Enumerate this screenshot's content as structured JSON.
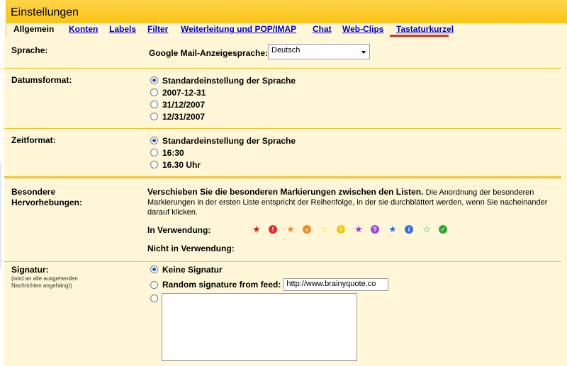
{
  "title": "Einstellungen",
  "tabs": [
    "Allgemein",
    "Konten",
    "Labels",
    "Filter",
    "Weiterleitung und POP/IMAP",
    "Chat",
    "Web-Clips",
    "Tastaturkurzel"
  ],
  "language": {
    "label": "Sprache:",
    "field_label": "Google Mail-Anzeigesprache:",
    "value": "Deutsch"
  },
  "date_format": {
    "label": "Datumsformat:",
    "options": [
      "Standardeinstellung der Sprache",
      "2007-12-31",
      "31/12/2007",
      "12/31/2007"
    ],
    "selected_index": 0
  },
  "time_format": {
    "label": "Zeitformat:",
    "options": [
      "Standardeinstellung der Sprache",
      "16:30",
      "16.30 Uhr"
    ],
    "selected_index": 0
  },
  "highlights": {
    "label_line1": "Besondere",
    "label_line2": "Hervorhebungen:",
    "desc_bold": "Verschieben Sie die besonderen Markierungen zwischen den Listen.",
    "desc_rest": "Die Anordnung der besonderen Markierungen in der ersten Liste entspricht der Reihenfolge, in der sie durchblättert werden, wenn Sie nacheinander darauf klicken.",
    "in_use_label": "In Verwendung:",
    "not_in_use_label": "Nicht in Verwendung:",
    "in_use_icons": [
      "red-star-icon",
      "red-bang-icon",
      "orange-star-icon",
      "orange-guillemet-icon",
      "yellow-star-icon",
      "yellow-bang-icon",
      "purple-star-icon",
      "purple-question-icon",
      "blue-star-icon",
      "blue-info-icon",
      "green-star-icon",
      "green-check-icon"
    ]
  },
  "signature": {
    "label": "Signatur:",
    "sublabel": "(wird an alle ausgehenden Nachrichten angehängt)",
    "option_none": "Keine Signatur",
    "option_feed": "Random signature from feed:",
    "feed_value": "http://www.brainyquote.co",
    "selected_index": 0
  },
  "colors": {
    "header": "#ffc61a",
    "panel": "#fff7d7",
    "link": "#0000cc",
    "accent_underline": "#e0341f"
  }
}
